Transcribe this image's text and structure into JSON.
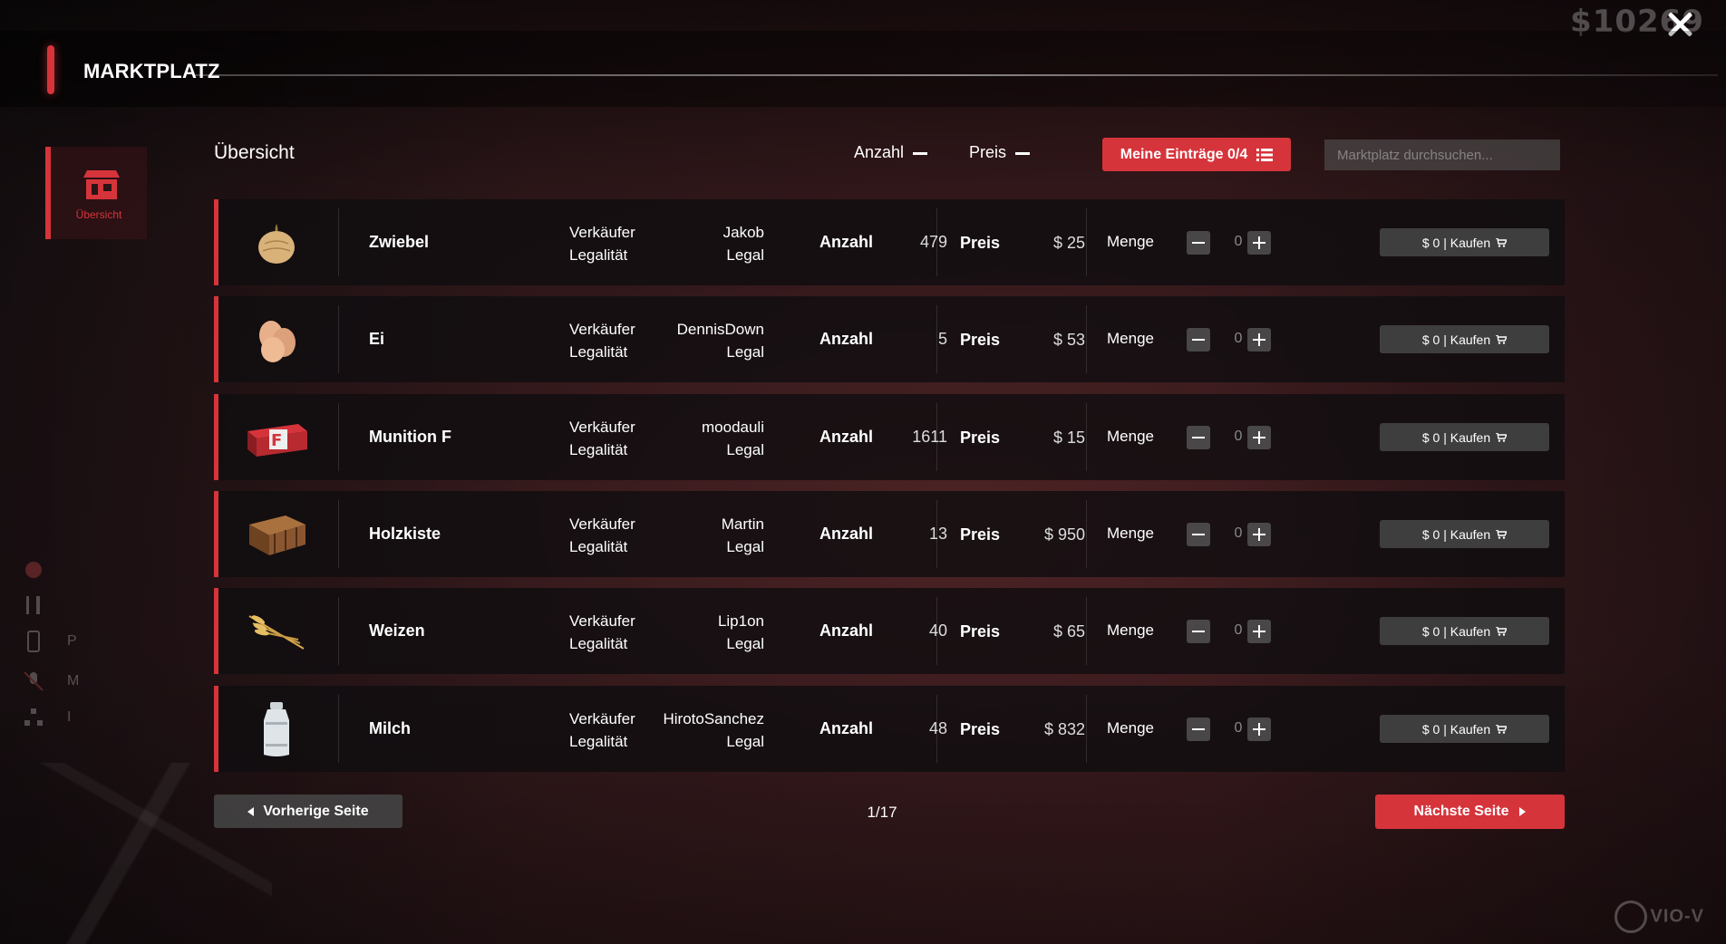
{
  "hud": {
    "money": "$10269"
  },
  "header": {
    "title": "MARKTPLATZ"
  },
  "sidebar": {
    "tab_label": "Übersicht"
  },
  "hud_left": {
    "letters": [
      "P",
      "M",
      "I"
    ]
  },
  "toolbar": {
    "title": "Übersicht",
    "sort_anzahl": "Anzahl",
    "sort_preis": "Preis",
    "my_entries": "Meine Einträge 0/4",
    "search_placeholder": "Marktplatz durchsuchen..."
  },
  "labels": {
    "seller": "Verkäufer",
    "legality": "Legalität",
    "anzahl": "Anzahl",
    "preis": "Preis",
    "menge": "Menge",
    "buy": "$ 0 |  Kaufen"
  },
  "items": [
    {
      "name": "Zwiebel",
      "seller": "Jakob",
      "legality": "Legal",
      "anzahl": "479",
      "preis": "$ 25",
      "qty": "0",
      "icon": "onion-icon"
    },
    {
      "name": "Ei",
      "seller": "DennisDown",
      "legality": "Legal",
      "anzahl": "5",
      "preis": "$ 53",
      "qty": "0",
      "icon": "egg-icon"
    },
    {
      "name": "Munition F",
      "seller": "moodauli",
      "legality": "Legal",
      "anzahl": "1611",
      "preis": "$ 15",
      "qty": "0",
      "icon": "ammo-box-icon"
    },
    {
      "name": "Holzkiste",
      "seller": "Martin",
      "legality": "Legal",
      "anzahl": "13",
      "preis": "$ 950",
      "qty": "0",
      "icon": "wooden-crate-icon"
    },
    {
      "name": "Weizen",
      "seller": "Lip1on",
      "legality": "Legal",
      "anzahl": "40",
      "preis": "$ 65",
      "qty": "0",
      "icon": "wheat-icon"
    },
    {
      "name": "Milch",
      "seller": "HirotoSanchez",
      "legality": "Legal",
      "anzahl": "48",
      "preis": "$ 832",
      "qty": "0",
      "icon": "milk-can-icon"
    }
  ],
  "pagination": {
    "prev": "Vorherige Seite",
    "next": "Nächste Seite",
    "indicator": "1/17"
  },
  "brand": "VIO-V",
  "colors": {
    "accent": "#d6343b",
    "row_bg": "#100e10",
    "button_grey": "#464648"
  }
}
